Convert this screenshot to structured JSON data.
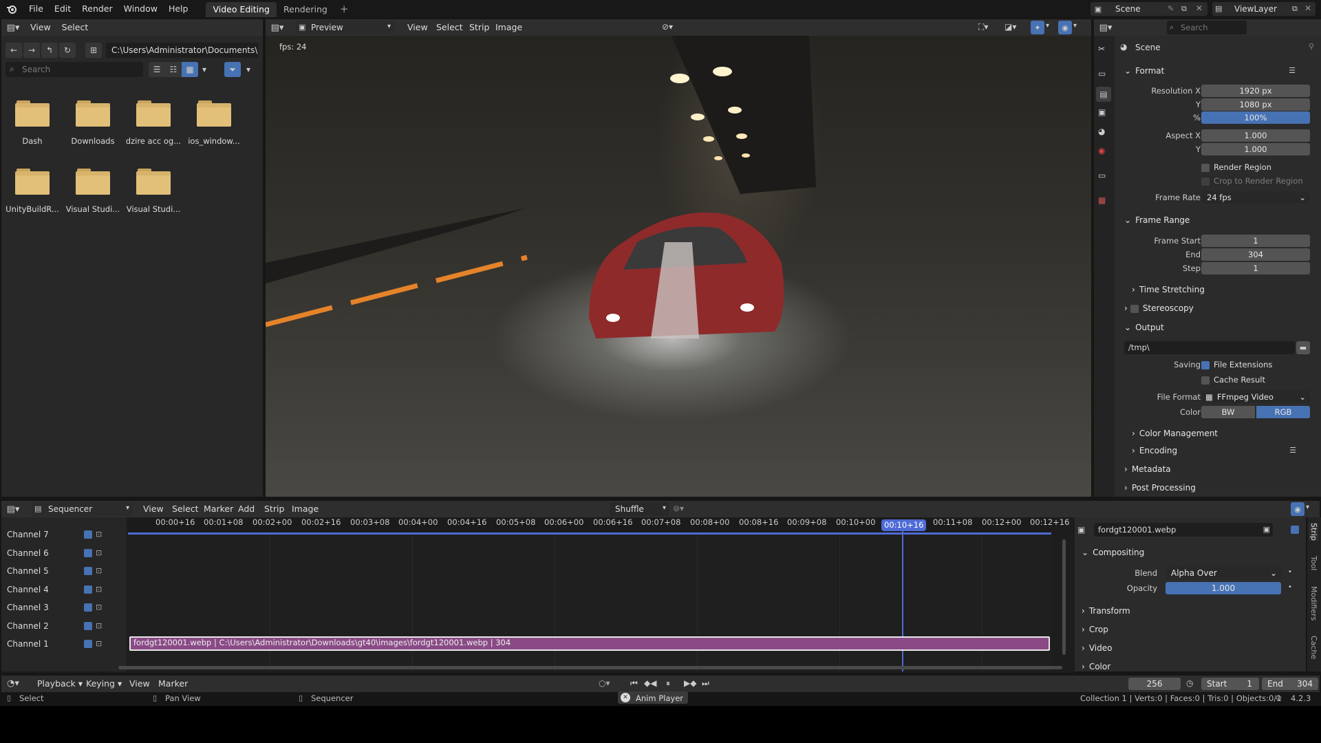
{
  "topbar": {
    "menus": [
      "File",
      "Edit",
      "Render",
      "Window",
      "Help"
    ],
    "tabs": [
      "Video Editing",
      "Rendering"
    ],
    "add_tab": "+",
    "scene": "Scene",
    "view_layer": "ViewLayer"
  },
  "file_browser": {
    "menus": [
      "View",
      "Select"
    ],
    "path": "C:\\Users\\Administrator\\Documents\\",
    "search_placeholder": "Search",
    "folders": [
      "Dash",
      "Downloads",
      "dzire acc og...",
      "ios_window...",
      "UnityBuildR...",
      "Visual Studi...",
      "Visual Studi..."
    ]
  },
  "preview": {
    "mode": "Preview",
    "menus": [
      "View",
      "Select",
      "Strip",
      "Image"
    ],
    "fps": "fps: 24"
  },
  "properties": {
    "search_placeholder": "Search",
    "scene_label": "Scene",
    "format": {
      "title": "Format",
      "res_x_label": "Resolution X",
      "res_x": "1920 px",
      "res_y_label": "Y",
      "res_y": "1080 px",
      "pct_label": "%",
      "pct": "100%",
      "aspect_x_label": "Aspect X",
      "aspect_x": "1.000",
      "aspect_y_label": "Y",
      "aspect_y": "1.000",
      "render_region": "Render Region",
      "crop_region": "Crop to Render Region",
      "frame_rate_label": "Frame Rate",
      "frame_rate": "24 fps"
    },
    "frame_range": {
      "title": "Frame Range",
      "start_label": "Frame Start",
      "start": "1",
      "end_label": "End",
      "end": "304",
      "step_label": "Step",
      "step": "1",
      "time_stretching": "Time Stretching"
    },
    "stereoscopy": "Stereoscopy",
    "output": {
      "title": "Output",
      "path": "/tmp\\",
      "saving_label": "Saving",
      "file_extensions": "File Extensions",
      "cache_result": "Cache Result",
      "file_format_label": "File Format",
      "file_format": "FFmpeg Video",
      "color_label": "Color",
      "color_bw": "BW",
      "color_rgb": "RGB",
      "color_management": "Color Management",
      "encoding": "Encoding"
    },
    "metadata": "Metadata",
    "post_processing": "Post Processing"
  },
  "sequencer": {
    "editor": "Sequencer",
    "menus": [
      "View",
      "Select",
      "Marker",
      "Add",
      "Strip",
      "Image"
    ],
    "shuffle": "Shuffle",
    "timecodes": [
      "00:00+16",
      "00:01+08",
      "00:02+00",
      "00:02+16",
      "00:03+08",
      "00:04+00",
      "00:04+16",
      "00:05+08",
      "00:06+00",
      "00:06+16",
      "00:07+08",
      "00:08+00",
      "00:08+16",
      "00:09+08",
      "00:10+00",
      "00:11+08",
      "00:12+00",
      "00:12+16"
    ],
    "current_time": "00:10+16",
    "channels": [
      "Channel 7",
      "Channel 6",
      "Channel 5",
      "Channel 4",
      "Channel 3",
      "Channel 2",
      "Channel 1"
    ],
    "strip_text": "fordgt120001.webp | C:\\Users\\Administrator\\Downloads\\gt40\\images\\fordgt120001.webp | 304",
    "strip_color": "#8a4a86"
  },
  "strip_panel": {
    "name": "fordgt120001.webp",
    "compositing": "Compositing",
    "blend_label": "Blend",
    "blend": "Alpha Over",
    "opacity_label": "Opacity",
    "opacity": "1.000",
    "sections": [
      "Transform",
      "Crop",
      "Video",
      "Color"
    ],
    "side_tabs": [
      "Strip",
      "Tool",
      "Modifiers",
      "Cache"
    ]
  },
  "playback": {
    "menus": [
      "Playback",
      "Keying",
      "View",
      "Marker"
    ],
    "current_frame": "256",
    "start_label": "Start",
    "start": "1",
    "end_label": "End",
    "end": "304"
  },
  "statusbar": {
    "select": "Select",
    "pan": "Pan View",
    "sequencer": "Sequencer",
    "anim_player": "Anim Player",
    "stats": "Collection 1 | Verts:0 | Faces:0 | Tris:0 | Objects:0/1",
    "version": "4.2.3"
  },
  "colors": {
    "accent": "#4772b3",
    "playhead": "#4f6bd6"
  }
}
